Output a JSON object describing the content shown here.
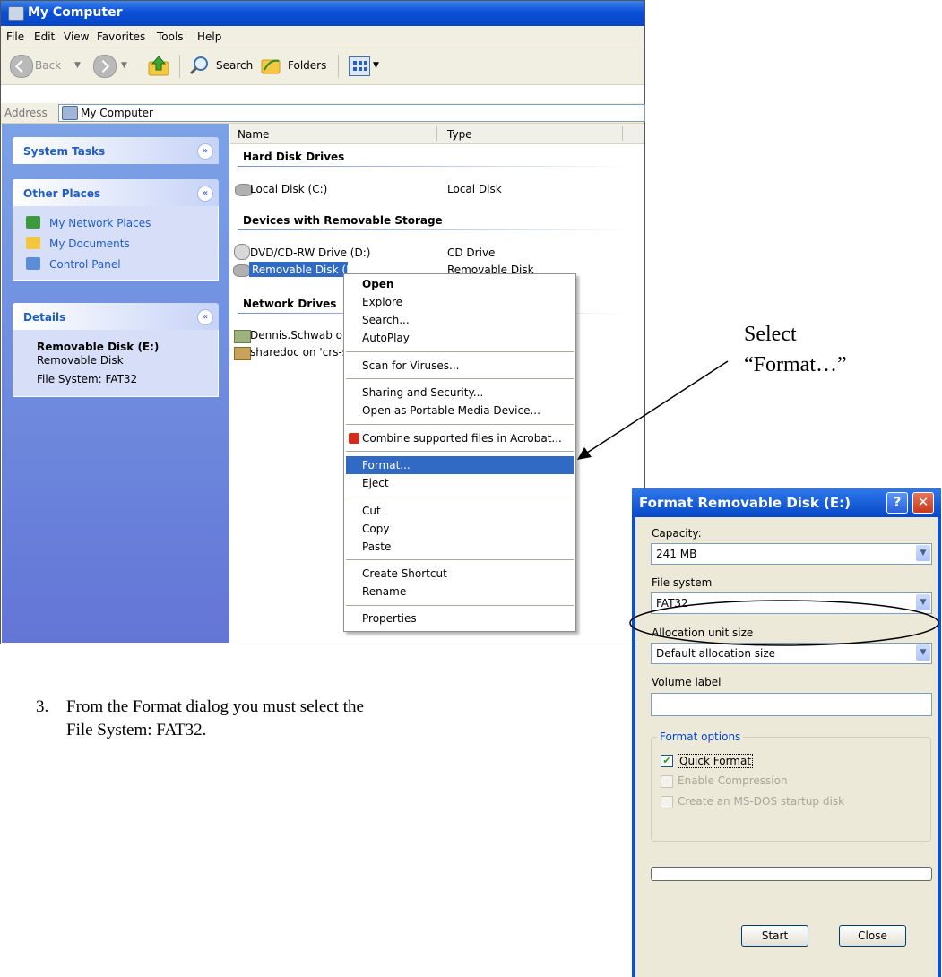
{
  "window": {
    "title": "My Computer",
    "menu": [
      "File",
      "Edit",
      "View",
      "Favorites",
      "Tools",
      "Help"
    ],
    "toolbar": {
      "back": "Back",
      "search": "Search",
      "folders": "Folders"
    },
    "address": {
      "label": "Address",
      "value": "My Computer"
    }
  },
  "taskpane": {
    "system_tasks": "System Tasks",
    "other_places": {
      "title": "Other Places",
      "links": [
        "My Network Places",
        "My Documents",
        "Control Panel"
      ]
    },
    "details": {
      "title": "Details",
      "name": "Removable Disk (E:)",
      "type": "Removable Disk",
      "fs": "File System: FAT32"
    }
  },
  "list": {
    "columns": [
      "Name",
      "Type"
    ],
    "groups": {
      "hard": "Hard Disk Drives",
      "removable": "Devices with Removable Storage",
      "network": "Network Drives"
    },
    "items": {
      "c_name": "Local Disk (C:)",
      "c_type": "Local Disk",
      "d_name": "DVD/CD-RW Drive (D:)",
      "d_type": "CD Drive",
      "e_name": "Removable Disk (E:)",
      "e_type": "Removable Disk",
      "n1_name": "Dennis.Schwab on",
      "n2_name": "sharedoc on 'crs-s"
    }
  },
  "context_menu": {
    "open": "Open",
    "explore": "Explore",
    "search": "Search...",
    "autoplay": "AutoPlay",
    "scan": "Scan for Viruses...",
    "sharing": "Sharing and Security...",
    "portable": "Open as Portable Media Device...",
    "combine": "Combine supported files in Acrobat...",
    "format": "Format...",
    "eject": "Eject",
    "cut": "Cut",
    "copy": "Copy",
    "paste": "Paste",
    "shortcut": "Create Shortcut",
    "rename": "Rename",
    "properties": "Properties"
  },
  "annotation": {
    "line1": "Select",
    "line2": "“Format…”"
  },
  "instruction": {
    "number": "3.",
    "line1": "From the Format dialog you must select the",
    "line2": "File System: FAT32."
  },
  "dialog": {
    "title": "Format Removable Disk (E:)",
    "help": "?",
    "close": "✕",
    "capacity_label": "Capacity:",
    "capacity": "241 MB",
    "fs_label": "File system",
    "fs": "FAT32",
    "alloc_label": "Allocation unit size",
    "alloc": "Default allocation size",
    "volume_label": "Volume label",
    "volume": "",
    "options_title": "Format options",
    "quick": "Quick Format",
    "compression": "Enable Compression",
    "msdos": "Create an MS-DOS startup disk",
    "start": "Start",
    "close_btn": "Close"
  }
}
